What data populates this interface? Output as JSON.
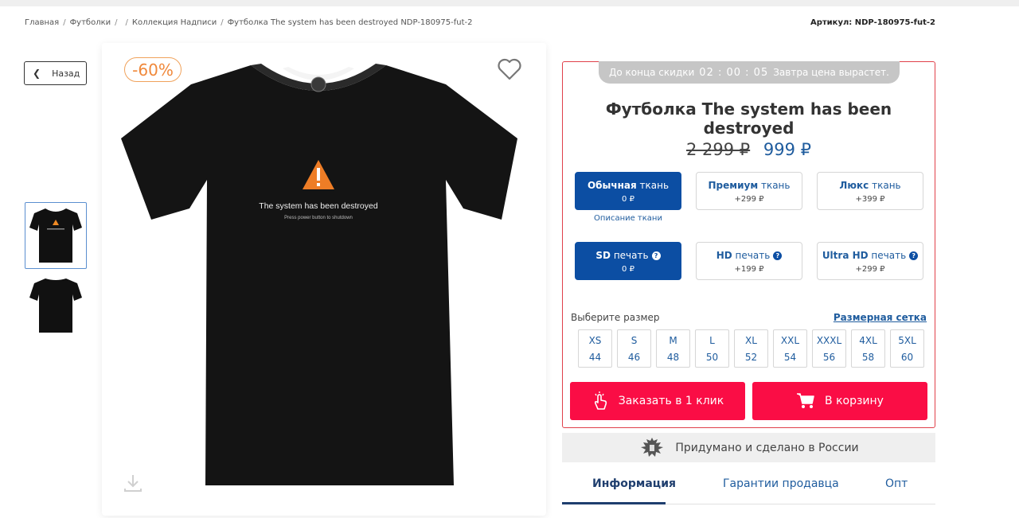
{
  "breadcrumb": [
    "Главная",
    "Футболки",
    "",
    "Коллекция Надписи",
    "Футболка The system has been destroyed NDP-180975-fut-2"
  ],
  "article": "Артикул: NDP-180975-fut-2",
  "back_label": "Назад",
  "discount_badge": "-60%",
  "shirt_print": {
    "headline": "The system has been destroyed",
    "subline": "Press power button to shutdown"
  },
  "timer": {
    "prefix": "До конца скидки",
    "time": "02 : 00 : 05",
    "suffix": "Завтра цена вырастет."
  },
  "product_title": "Футболка The system has been destroyed",
  "price": {
    "old": "2 299 ₽",
    "new": "999 ₽"
  },
  "fabric_options": [
    {
      "bold": "Обычная",
      "rest": " ткань",
      "price": "0 ₽",
      "selected": true
    },
    {
      "bold": "Премиум",
      "rest": " ткань",
      "price": "+299 ₽",
      "selected": false
    },
    {
      "bold": "Люкс",
      "rest": " ткань",
      "price": "+399 ₽",
      "selected": false
    }
  ],
  "fabric_description_link": "Описание ткани",
  "print_options": [
    {
      "bold": "SD",
      "rest": " печать",
      "price": "0 ₽",
      "selected": true
    },
    {
      "bold": "HD",
      "rest": " печать",
      "price": "+199 ₽",
      "selected": false
    },
    {
      "bold": "Ultra HD",
      "rest": " печать",
      "price": "+299 ₽",
      "selected": false
    }
  ],
  "size_label": "Выберите размер",
  "size_chart_link": "Размерная сетка",
  "sizes": [
    {
      "code": "XS",
      "num": "44"
    },
    {
      "code": "S",
      "num": "46"
    },
    {
      "code": "M",
      "num": "48"
    },
    {
      "code": "L",
      "num": "50"
    },
    {
      "code": "XL",
      "num": "52"
    },
    {
      "code": "XXL",
      "num": "54"
    },
    {
      "code": "XXXL",
      "num": "56"
    },
    {
      "code": "4XL",
      "num": "58"
    },
    {
      "code": "5XL",
      "num": "60"
    }
  ],
  "buy_one_click": "Заказать в 1 клик",
  "add_to_cart": "В корзину",
  "made_in_russia": "Придумано и сделано в России",
  "tabs": [
    "Информация",
    "Гарантии продавца",
    "Опт"
  ],
  "colors": {
    "accent_red": "#fa0d45",
    "selected_blue": "#0c4ea3",
    "link_blue": "#1f5c9e",
    "discount_orange": "#f0883a"
  }
}
